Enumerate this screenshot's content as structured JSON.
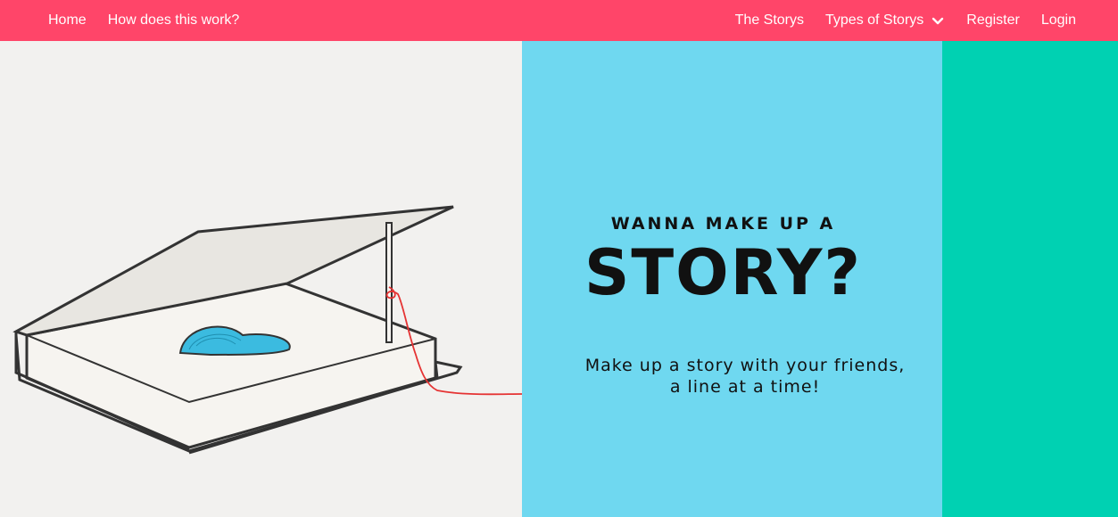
{
  "nav": {
    "left": [
      {
        "label": "Home"
      },
      {
        "label": "How does this work?"
      }
    ],
    "right": {
      "the_storys": "The Storys",
      "types_dropdown": "Types of Storys",
      "register": "Register",
      "login": "Login"
    }
  },
  "hero": {
    "eyebrow": "WANNA MAKE UP A",
    "headline": "STORY?",
    "tagline_line1": "Make up a story with your friends,",
    "tagline_line2": "a line at a time!"
  },
  "colors": {
    "navbar": "#ff4569",
    "panel_left": "#f2f1ef",
    "panel_mid": "#6fd8f0",
    "panel_right": "#00d1b2",
    "heart": "#3bbbe0",
    "string": "#e53333"
  },
  "icons": {
    "dropdown": "chevron-down-icon"
  }
}
